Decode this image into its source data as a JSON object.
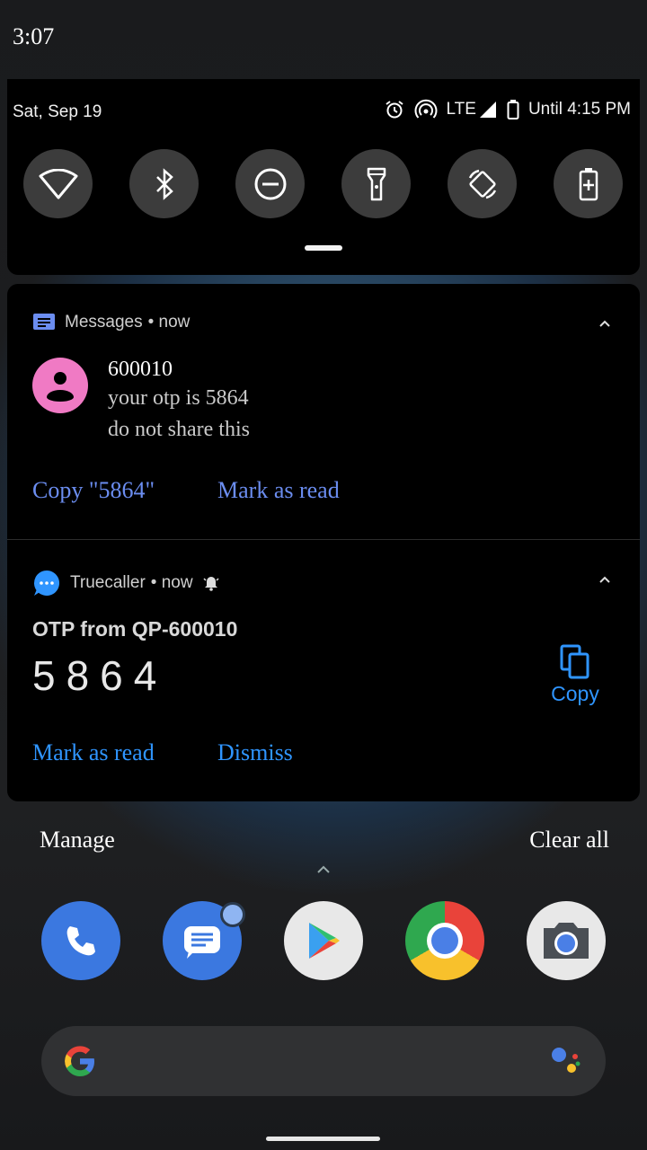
{
  "status_bar": {
    "time": "3:07"
  },
  "quick_settings": {
    "date": "Sat, Sep 19",
    "network": "LTE",
    "battery_text": "Until 4:15 PM",
    "tiles": [
      "wifi-icon",
      "bluetooth-icon",
      "do-not-disturb-icon",
      "flashlight-icon",
      "auto-rotate-icon",
      "battery-saver-icon"
    ]
  },
  "notifications": [
    {
      "app": "Messages",
      "time": "• now",
      "sender": "600010",
      "lines": [
        "your otp is 5864",
        "do not share this"
      ],
      "actions": [
        "Copy \"5864\"",
        "Mark as read"
      ]
    },
    {
      "app": "Truecaller",
      "time": "• now",
      "title": "OTP from QP-600010",
      "code": "5864",
      "copy_label": "Copy",
      "actions": [
        "Mark as read",
        "Dismiss"
      ]
    }
  ],
  "footer": {
    "manage": "Manage",
    "clear_all": "Clear all"
  },
  "dock": [
    "phone-app-icon",
    "messages-app-icon",
    "play-store-app-icon",
    "chrome-app-icon",
    "camera-app-icon"
  ],
  "colors": {
    "accent_messages": "#6b8df0",
    "accent_truecaller": "#2f95ff",
    "avatar": "#f07ac4"
  }
}
